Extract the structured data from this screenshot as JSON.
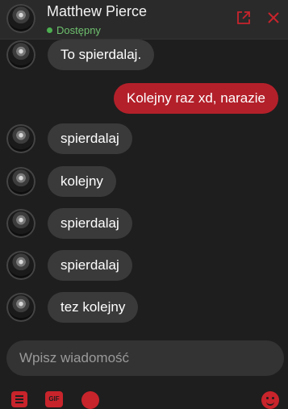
{
  "header": {
    "name": "Matthew Pierce",
    "status": "Dostępny",
    "popout_icon": "external-link-icon",
    "close_icon": "close-icon"
  },
  "messages": [
    {
      "direction": "incoming",
      "text": "To spierdalaj."
    },
    {
      "direction": "outgoing",
      "text": "Kolejny raz xd, narazie"
    },
    {
      "direction": "incoming",
      "text": "spierdalaj"
    },
    {
      "direction": "incoming",
      "text": "kolejny"
    },
    {
      "direction": "incoming",
      "text": "spierdalaj"
    },
    {
      "direction": "incoming",
      "text": "spierdalaj"
    },
    {
      "direction": "incoming",
      "text": "tez kolejny"
    }
  ],
  "composer": {
    "placeholder": "Wpisz wiadomość",
    "value": ""
  },
  "toolbar": {
    "gif_label": "GIF",
    "icons": [
      "document-icon",
      "gif-icon",
      "record-icon",
      "emoji-icon"
    ]
  },
  "colors": {
    "accent": "#c8242c",
    "outgoing_bubble": "#b3202a",
    "incoming_bubble": "#3a3a3a",
    "status_online": "#4caf50",
    "background": "#1e1e1e"
  }
}
